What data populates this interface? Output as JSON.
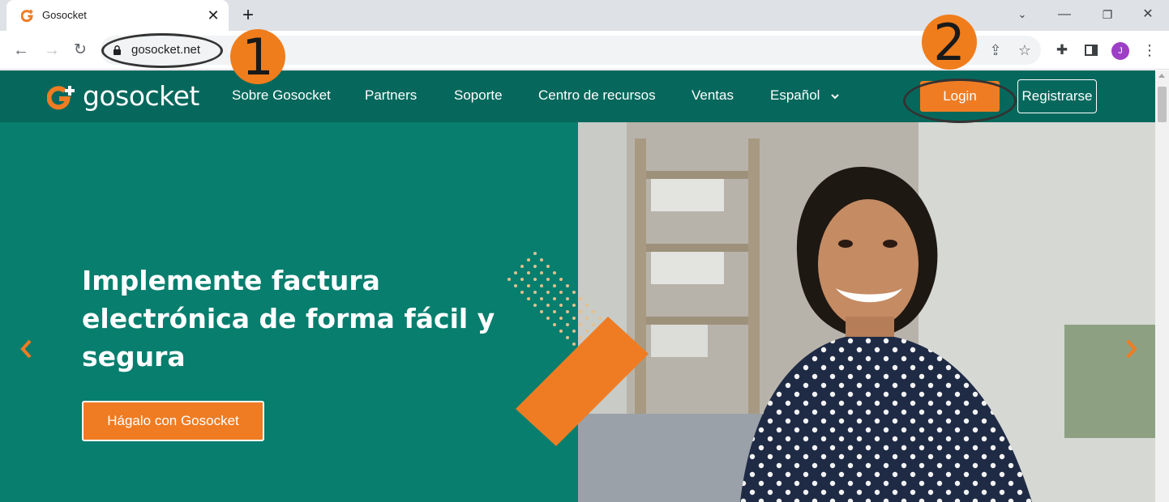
{
  "browser": {
    "tab_title": "Gosocket",
    "url": "gosocket.net",
    "profile_initial": "J",
    "profile_color": "#9c3ec6"
  },
  "annotations": {
    "step1": "1",
    "step2": "2",
    "badge_color": "#f07d1c"
  },
  "site": {
    "logo_text": "gosocket",
    "nav_items": [
      "Sobre Gosocket",
      "Partners",
      "Soporte",
      "Centro de recursos",
      "Ventas",
      "Español"
    ],
    "login_label": "Login",
    "register_label": "Registrarse",
    "header_color": "#06685c",
    "accent_color": "#ef7c23"
  },
  "hero": {
    "title_lines": [
      "Implemente factura",
      "electrónica de forma fácil y",
      "segura"
    ],
    "cta_label": "Hágalo con Gosocket",
    "background_color": "#077e6e"
  }
}
